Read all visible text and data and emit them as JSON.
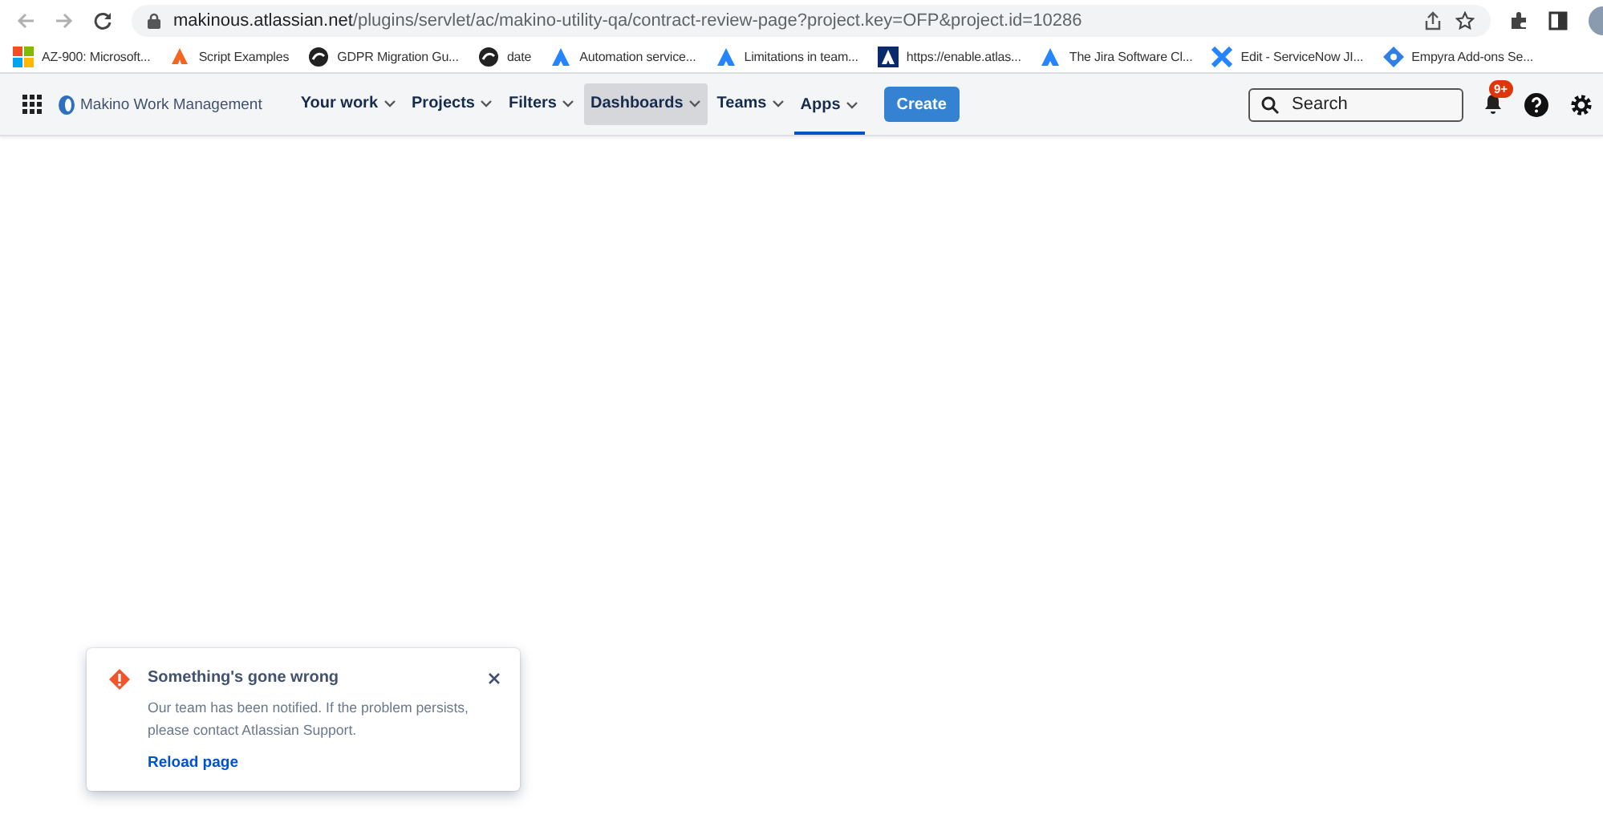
{
  "browser": {
    "url_host": "makinous.atlassian.net",
    "url_path": "/plugins/servlet/ac/makino-utility-qa/contract-review-page?project.key=OFP&project.id=10286"
  },
  "bookmarks": [
    {
      "kind": "windows",
      "label": "AZ-900: Microsoft..."
    },
    {
      "kind": "flame",
      "label": "Script Examples"
    },
    {
      "kind": "dark",
      "label": "GDPR Migration Gu..."
    },
    {
      "kind": "dark",
      "label": "date"
    },
    {
      "kind": "atlassian",
      "label": "Automation service..."
    },
    {
      "kind": "atlassian",
      "label": "Limitations in team..."
    },
    {
      "kind": "atlassian-box",
      "label": "https://enable.atlas..."
    },
    {
      "kind": "atlassian",
      "label": "The Jira Software Cl..."
    },
    {
      "kind": "cross",
      "label": "Edit - ServiceNow JI..."
    },
    {
      "kind": "diamond",
      "label": "Empyra Add-ons Se..."
    }
  ],
  "app": {
    "title": "Makino Work Management",
    "nav": [
      {
        "label": "Your work",
        "highlighted": false,
        "current": false
      },
      {
        "label": "Projects",
        "highlighted": false,
        "current": false
      },
      {
        "label": "Filters",
        "highlighted": false,
        "current": false
      },
      {
        "label": "Dashboards",
        "highlighted": true,
        "current": false
      },
      {
        "label": "Teams",
        "highlighted": false,
        "current": false
      },
      {
        "label": "Apps",
        "highlighted": false,
        "current": true
      }
    ],
    "create": "Create",
    "search": {
      "placeholder": "Search"
    },
    "notification_badge": "9+"
  },
  "toast": {
    "title": "Something's gone wrong",
    "message": "Our team has been notified. If the problem persists, please contact Atlassian Support.",
    "link": "Reload page"
  }
}
